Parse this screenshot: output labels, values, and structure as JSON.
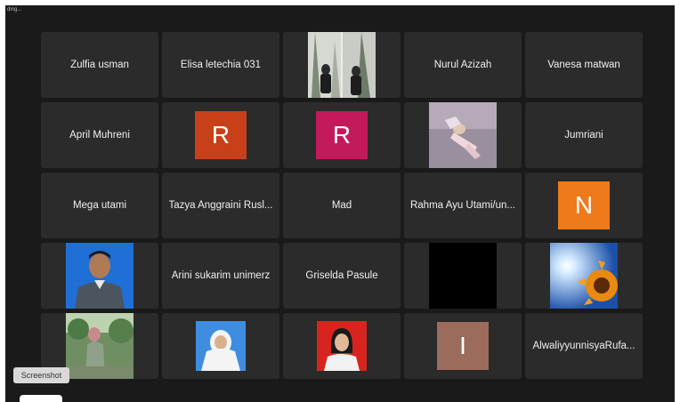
{
  "window": {
    "status_text": "ding..."
  },
  "tooltip": {
    "label": "Screenshot"
  },
  "tiles": [
    {
      "kind": "name",
      "label": "Zulfia usman"
    },
    {
      "kind": "name",
      "label": "Elisa letechia 031"
    },
    {
      "kind": "photo",
      "photo": "two-people-forest-photo"
    },
    {
      "kind": "name",
      "label": "Nurul Azizah"
    },
    {
      "kind": "name",
      "label": "Vanesa matwan"
    },
    {
      "kind": "name",
      "label": "April Muhreni"
    },
    {
      "kind": "avatar",
      "initial": "R",
      "color": "#c8401a"
    },
    {
      "kind": "avatar",
      "initial": "R",
      "color": "#c21a5a"
    },
    {
      "kind": "photo",
      "photo": "person-lying-photo"
    },
    {
      "kind": "name",
      "label": "Jumriani"
    },
    {
      "kind": "name",
      "label": "Mega utami"
    },
    {
      "kind": "name",
      "label": "Tazya Anggraini Rusl..."
    },
    {
      "kind": "name",
      "label": "Mad"
    },
    {
      "kind": "name",
      "label": "Rahma Ayu Utami/un..."
    },
    {
      "kind": "avatar",
      "initial": "N",
      "color": "#ee7a1a"
    },
    {
      "kind": "photo",
      "photo": "man-blue-background-photo"
    },
    {
      "kind": "name",
      "label": "Arini sukarim unimerz"
    },
    {
      "kind": "name",
      "label": "Griselda Pasule"
    },
    {
      "kind": "photo",
      "photo": "black-video-photo"
    },
    {
      "kind": "photo",
      "photo": "sunflower-sun-photo"
    },
    {
      "kind": "photo",
      "photo": "woman-garden-photo"
    },
    {
      "kind": "photo",
      "photo": "woman-hijab-photo"
    },
    {
      "kind": "photo",
      "photo": "woman-red-background-photo"
    },
    {
      "kind": "avatar",
      "initial": "I",
      "color": "#9b6b5c"
    },
    {
      "kind": "name",
      "label": "AlwaliyyunnisyaRufa..."
    }
  ]
}
